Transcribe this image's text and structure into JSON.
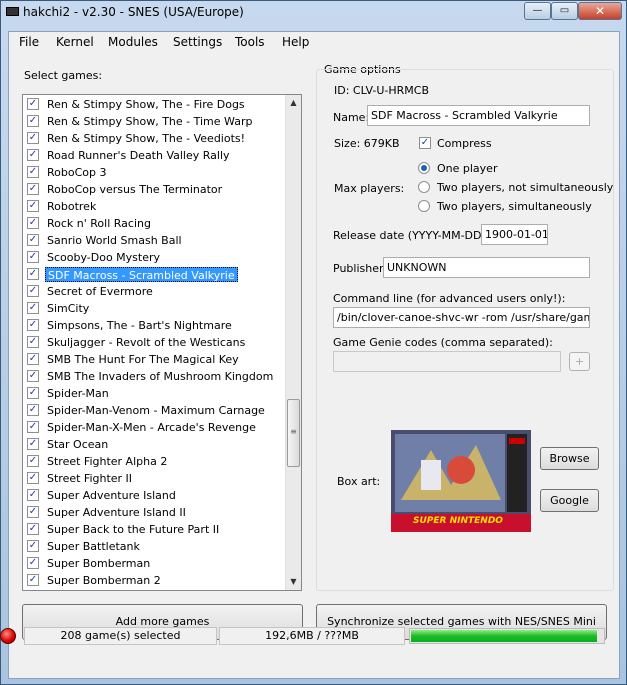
{
  "window": {
    "title": "hakchi2 - v2.30 - SNES (USA/Europe)",
    "minimize_label": "—",
    "maximize_label": "▭",
    "close_label": "✕"
  },
  "menu": [
    "File",
    "Kernel",
    "Modules",
    "Settings",
    "Tools",
    "Help"
  ],
  "games_label": "Select games:",
  "games": [
    {
      "name": "Ren & Stimpy Show, The - Fire Dogs",
      "checked": true
    },
    {
      "name": "Ren & Stimpy Show, The - Time Warp",
      "checked": true
    },
    {
      "name": "Ren & Stimpy Show, The - Veediots!",
      "checked": true
    },
    {
      "name": "Road Runner's Death Valley Rally",
      "checked": true
    },
    {
      "name": "RoboCop 3",
      "checked": true
    },
    {
      "name": "RoboCop versus The Terminator",
      "checked": true
    },
    {
      "name": "Robotrek",
      "checked": true
    },
    {
      "name": "Rock n' Roll Racing",
      "checked": true
    },
    {
      "name": "Sanrio World Smash Ball",
      "checked": true
    },
    {
      "name": "Scooby-Doo Mystery",
      "checked": true
    },
    {
      "name": "SDF Macross - Scrambled Valkyrie",
      "checked": true,
      "selected": true
    },
    {
      "name": "Secret of Evermore",
      "checked": true
    },
    {
      "name": "SimCity",
      "checked": true
    },
    {
      "name": "Simpsons, The - Bart's Nightmare",
      "checked": true
    },
    {
      "name": "Skuljagger - Revolt of the Westicans",
      "checked": true
    },
    {
      "name": "SMB The Hunt For The Magical Key",
      "checked": true
    },
    {
      "name": "SMB The Invaders of Mushroom Kingdom",
      "checked": true
    },
    {
      "name": "Spider-Man",
      "checked": true
    },
    {
      "name": "Spider-Man-Venom - Maximum Carnage",
      "checked": true
    },
    {
      "name": "Spider-Man-X-Men - Arcade's Revenge",
      "checked": true
    },
    {
      "name": "Star Ocean",
      "checked": true
    },
    {
      "name": "Street Fighter Alpha 2",
      "checked": true
    },
    {
      "name": "Street Fighter II",
      "checked": true
    },
    {
      "name": "Super Adventure Island",
      "checked": true
    },
    {
      "name": "Super Adventure Island II",
      "checked": true
    },
    {
      "name": "Super Back to the Future Part II",
      "checked": true
    },
    {
      "name": "Super Battletank",
      "checked": true
    },
    {
      "name": "Super Bomberman",
      "checked": true
    },
    {
      "name": "Super Bomberman 2",
      "checked": true
    }
  ],
  "options": {
    "group_title": "Game options",
    "id_text": "ID: CLV-U-HRMCB",
    "name_label": "Name:",
    "name_value": "SDF Macross - Scrambled Valkyrie",
    "size_text": "Size: 679KB",
    "compress_label": "Compress",
    "compress_checked": true,
    "max_players_label": "Max players:",
    "player_options": [
      "One player",
      "Two players, not simultaneously",
      "Two players, simultaneously"
    ],
    "player_selected": 0,
    "release_label": "Release date (YYYY-MM-DD):",
    "release_value": "1900-01-01",
    "publisher_label": "Publisher:",
    "publisher_value": "UNKNOWN",
    "cmdline_label": "Command line (for advanced users only!):",
    "cmdline_value": "/bin/clover-canoe-shvc-wr -rom /usr/share/games/C",
    "genie_label": "Game Genie codes (comma separated):",
    "genie_value": "",
    "genie_add_label": "+",
    "boxart_label": "Box art:",
    "browse_label": "Browse",
    "google_label": "Google",
    "boxart_text": "SUPER NINTENDO"
  },
  "buttons": {
    "add_games": "Add more games",
    "sync": "Synchronize selected games with NES/SNES Mini"
  },
  "status": {
    "selected_text": "208 game(s) selected",
    "size_text": "192,6MB / ???MB",
    "progress": 0.97,
    "progress_color": "#22b922"
  },
  "colors": {
    "selection": "#3399ff",
    "titlebar": "#b9d1ea",
    "close": "#c4412b"
  }
}
